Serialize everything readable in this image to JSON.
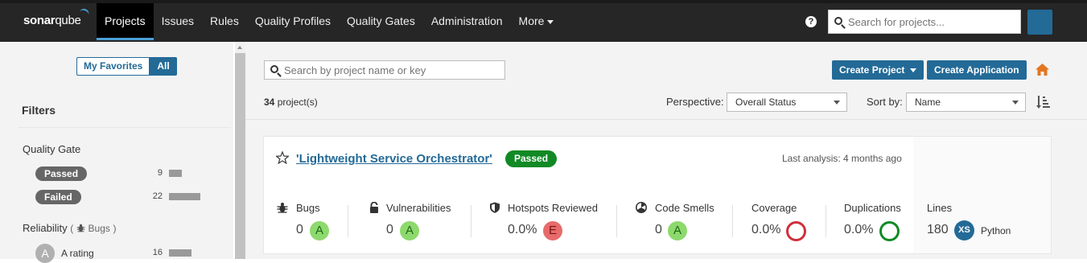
{
  "header": {
    "logo_bold": "sonar",
    "logo_light": "qube",
    "nav": [
      {
        "label": "Projects",
        "active": true
      },
      {
        "label": "Issues"
      },
      {
        "label": "Rules"
      },
      {
        "label": "Quality Profiles"
      },
      {
        "label": "Quality Gates"
      },
      {
        "label": "Administration"
      },
      {
        "label": "More"
      }
    ],
    "help_label": "?",
    "search_placeholder": "Search for projects...",
    "icons": [
      "help-icon",
      "search-icon",
      "avatar"
    ]
  },
  "sidebar": {
    "favorites_label": "My Favorites",
    "all_label": "All",
    "filters_title": "Filters",
    "quality_gate": {
      "title": "Quality Gate",
      "items": [
        {
          "label": "Passed",
          "count": "9",
          "fraction": 0.41
        },
        {
          "label": "Failed",
          "count": "22",
          "fraction": 1.0
        }
      ]
    },
    "reliability": {
      "title": "Reliability",
      "paren_open": "(",
      "sub": "Bugs",
      "paren_close": ")",
      "items": [
        {
          "grade": "A",
          "label": "A rating",
          "count": "16",
          "fraction": 0.73
        }
      ]
    }
  },
  "main": {
    "search_placeholder": "Search by project name or key",
    "create_project_label": "Create Project",
    "create_application_label": "Create Application",
    "project_count": "34",
    "project_count_suffix": " project(s)",
    "perspective_label": "Perspective:",
    "perspective_value": "Overall Status",
    "sort_label": "Sort by:",
    "sort_value": "Name"
  },
  "project": {
    "name": "'Lightweight Service Orchestrator'",
    "status": "Passed",
    "last_analysis": "Last analysis: 4 months ago",
    "metrics": {
      "bugs": {
        "label": "Bugs",
        "value": "0",
        "grade": "A"
      },
      "vulnerabilities": {
        "label": "Vulnerabilities",
        "value": "0",
        "grade": "A"
      },
      "hotspots": {
        "label": "Hotspots Reviewed",
        "value": "0.0%",
        "grade": "E"
      },
      "code_smells": {
        "label": "Code Smells",
        "value": "0",
        "grade": "A"
      },
      "coverage": {
        "label": "Coverage",
        "value": "0.0%"
      },
      "duplications": {
        "label": "Duplications",
        "value": "0.0%"
      },
      "lines": {
        "label": "Lines",
        "value": "180",
        "size": "XS",
        "language": "Python"
      }
    }
  },
  "colors": {
    "topbar": "#262626",
    "primary": "#236a97",
    "passed": "#118a25",
    "grade_a": "#8dd96d",
    "grade_e": "#e86b6b",
    "coverage_ring": "#d02f3a",
    "duplications_ring": "#118a25",
    "annotation_arrow": "#e0262b"
  }
}
